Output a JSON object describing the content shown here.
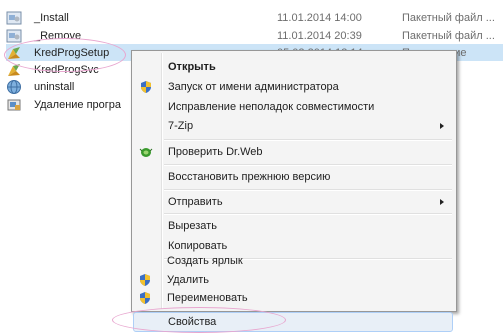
{
  "files": [
    {
      "name": "_Install",
      "date": "11.01.2014 14:00",
      "type": "Пакетный файл ...",
      "icon": "batch-file-icon"
    },
    {
      "name": "_Remove",
      "date": "11.01.2014 20:39",
      "type": "Пакетный файл ...",
      "icon": "batch-file-icon"
    },
    {
      "name": "KredProgSetup",
      "date": "05.02.2014 13:14",
      "type": "Приложение",
      "icon": "application-icon"
    },
    {
      "name": "KredProgSvc",
      "date": "",
      "type": "ение",
      "icon": "application-icon"
    },
    {
      "name": "uninstall",
      "date": "",
      "type": "ение",
      "icon": "uninstall-icon"
    },
    {
      "name": "Удаление програ",
      "date": "",
      "type": "",
      "icon": "setup-icon"
    }
  ],
  "context_menu": {
    "open": "Открыть",
    "run_as_admin": "Запуск от имени администратора",
    "troubleshoot": "Исправление неполадок совместимости",
    "seven_zip": "7-Zip",
    "drweb": "Проверить Dr.Web",
    "restore": "Восстановить прежнюю версию",
    "send_to": "Отправить",
    "cut": "Вырезать",
    "copy": "Копировать",
    "create_shortcut": "Создать ярлык",
    "delete": "Удалить",
    "rename": "Переименовать",
    "properties": "Свойства"
  },
  "colors": {
    "selection": "#cce4f7",
    "menu_bg": "#f4f4f4",
    "annotation": "#e8a6cf"
  }
}
